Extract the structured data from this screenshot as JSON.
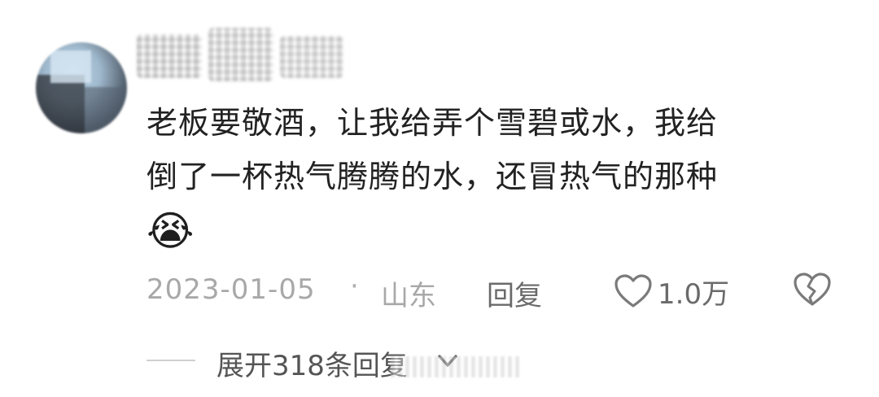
{
  "comment": {
    "avatar_icon": "user-avatar",
    "text_lines": [
      "老板要敬酒，让我给弄个雪碧或水，我给",
      "倒了一杯热气腾腾的水，还冒热气的那种"
    ],
    "emoji": "😭",
    "emoji_icon": "loudly-crying-face-icon",
    "meta": {
      "date": "2023-01-05",
      "separator": "·",
      "location": "山东",
      "reply_label": "回复",
      "like_icon": "heart-outline-icon",
      "like_count": "1.0万",
      "dislike_icon": "broken-heart-icon"
    },
    "expand": {
      "label": "展开318条回复",
      "chevron_icon": "chevron-down-icon"
    }
  },
  "colors": {
    "text_primary": "#222222",
    "text_muted": "#a8a8a8",
    "text_secondary": "#6a6a6a",
    "divider": "#d0d0d0"
  }
}
